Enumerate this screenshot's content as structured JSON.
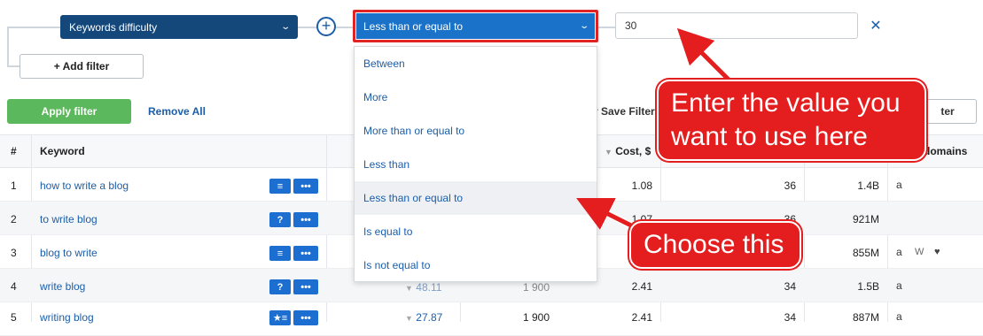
{
  "filter": {
    "field_select": "Keywords difficulty",
    "operator_select": "Less than or equal to",
    "value": "30",
    "add_filter_label": "+ Add filter",
    "apply_label": "Apply filter",
    "remove_all_label": "Remove All",
    "save_filter_label": "r Save Filter",
    "filter_button_label": "ter"
  },
  "dropdown": {
    "options": [
      "Between",
      "More",
      "More than or equal to",
      "Less than",
      "Less than or equal to",
      "Is equal to",
      "Is not equal to"
    ],
    "active": "Less than or equal to"
  },
  "table": {
    "headers": {
      "num": "#",
      "keyword": "Keyword",
      "cost": "Cost, $",
      "domains": "domains"
    },
    "rows": [
      {
        "n": "1",
        "keyword": "how to write a blog",
        "kd": "",
        "volume": "",
        "cost": "1.08",
        "comp": "36",
        "results": "1.4B",
        "domains": "a"
      },
      {
        "n": "2",
        "keyword": "to write blog",
        "kd": "",
        "volume": "",
        "cost": "1.07",
        "comp": "36",
        "results": "921M",
        "domains": ""
      },
      {
        "n": "3",
        "keyword": "blog to write",
        "kd": "",
        "volume": "",
        "cost": "",
        "comp": "",
        "results": "855M",
        "domains": "a W"
      },
      {
        "n": "4",
        "keyword": "write blog",
        "kd": "48.11",
        "volume": "1 900",
        "cost": "2.41",
        "comp": "34",
        "results": "1.5B",
        "domains": "a"
      },
      {
        "n": "5",
        "keyword": "writing blog",
        "kd": "27.87",
        "volume": "1 900",
        "cost": "2.41",
        "comp": "34",
        "results": "887M",
        "domains": "a"
      }
    ]
  },
  "callouts": {
    "value_line1": "Enter the value you",
    "value_line2": "want to use here",
    "choose": "Choose this"
  },
  "colors": {
    "accent": "#1a73c9",
    "dark": "#14477a",
    "callout": "#e41e1e",
    "apply": "#5cb85c"
  }
}
